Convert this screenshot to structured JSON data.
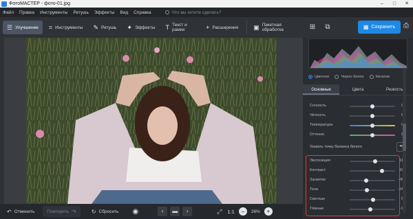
{
  "window": {
    "title": "ФотоМАСТЕР - фото-01.jpg",
    "controls": [
      "–",
      "□",
      "✕"
    ]
  },
  "menu": {
    "items": [
      "Файл",
      "Правка",
      "Инструменты",
      "Ретушь",
      "Эффекты",
      "Вид",
      "Справка"
    ],
    "search_placeholder": "Что вы хотите сделать?"
  },
  "toolbar": {
    "tabs": [
      {
        "label": "Улучшение",
        "icon": "sliders-icon"
      },
      {
        "label": "Инструменты",
        "icon": "crop-icon"
      },
      {
        "label": "Ретушь",
        "icon": "brush-icon"
      },
      {
        "label": "Эффекты",
        "icon": "sparkle-icon"
      },
      {
        "label": "Текст и рамки",
        "icon": "text-icon"
      },
      {
        "label": "Расширения",
        "icon": "plus-icon"
      },
      {
        "label": "Пакетная обработка",
        "icon": "batch-icon"
      }
    ]
  },
  "header_right": {
    "save_label": "Сохранить"
  },
  "bottom": {
    "undo_label": "Отменить",
    "redo_label": "Повторить",
    "reset_label": "Сбросить",
    "zoom_ratio": "1:1",
    "zoom_percent": "26%"
  },
  "panel": {
    "modes": [
      "Цветное",
      "Черно-белое",
      "Негатив"
    ],
    "selected_mode": 0,
    "tabs": [
      "Основные",
      "Цвета",
      "Резкость"
    ],
    "active_tab": 0,
    "top_sliders": [
      {
        "label": "Сочность",
        "value": "0",
        "level": 0.5
      },
      {
        "label": "Чёткость",
        "value": "0",
        "level": 0.5
      },
      {
        "label": "Температура",
        "value": "0",
        "level": 0.5
      },
      {
        "label": "Оттенок",
        "value": "0",
        "level": 0.5
      }
    ],
    "white_balance_label": "Указать точку баланса белого",
    "bottom_sliders": [
      {
        "label": "Экспозиция",
        "value": "11",
        "level": 0.56
      },
      {
        "label": "Контраст",
        "value": "43",
        "level": 0.71
      },
      {
        "label": "Засветки",
        "value": "-26",
        "level": 0.37
      },
      {
        "label": "Тени",
        "value": "-24",
        "level": 0.38
      },
      {
        "label": "Светлые",
        "value": "5",
        "level": 0.52
      },
      {
        "label": "Тёмные",
        "value": "-9",
        "level": 0.45
      }
    ]
  },
  "colors": {
    "accent": "#1e88e5",
    "highlight_border": "#e53935"
  }
}
